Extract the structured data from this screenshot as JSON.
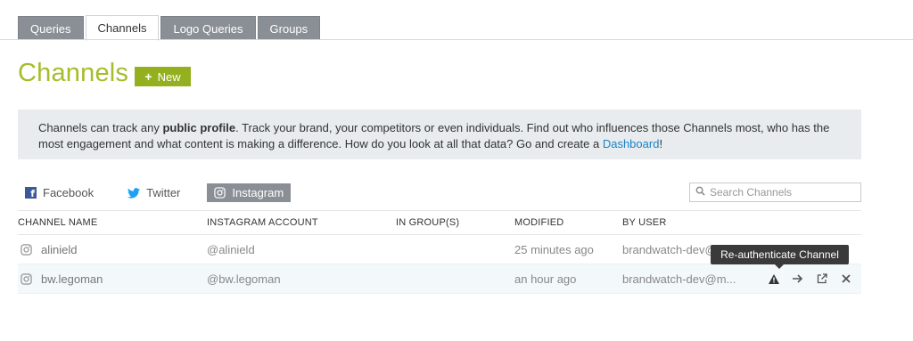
{
  "tabs": [
    {
      "label": "Queries",
      "active": false
    },
    {
      "label": "Channels",
      "active": true
    },
    {
      "label": "Logo Queries",
      "active": false
    },
    {
      "label": "Groups",
      "active": false
    }
  ],
  "page": {
    "title": "Channels",
    "new_label": "New"
  },
  "info": {
    "text_1": "Channels can track any ",
    "bold": "public profile",
    "text_2": ". Track your brand, your competitors or even individuals. Find out who influences those Channels most, who has the most engagement and what content is making a difference. How do you look at all that data? Go and create a ",
    "link": "Dashboard",
    "text_3": "!"
  },
  "networks": [
    {
      "label": "Facebook",
      "icon": "facebook-icon",
      "active": false
    },
    {
      "label": "Twitter",
      "icon": "twitter-icon",
      "active": false
    },
    {
      "label": "Instagram",
      "icon": "instagram-icon",
      "active": true
    }
  ],
  "search": {
    "placeholder": "Search Channels"
  },
  "table": {
    "headers": [
      "CHANNEL NAME",
      "INSTAGRAM ACCOUNT",
      "IN GROUP(S)",
      "MODIFIED",
      "BY USER"
    ],
    "rows": [
      {
        "name": "alinield",
        "account": "@alinield",
        "groups": "",
        "modified": "25 minutes ago",
        "user": "brandwatch-dev@"
      },
      {
        "name": "bw.legoman",
        "account": "@bw.legoman",
        "groups": "",
        "modified": "an hour ago",
        "user": "brandwatch-dev@m..."
      }
    ]
  },
  "tooltip": {
    "text": "Re-authenticate Channel"
  },
  "colors": {
    "accent": "#a6bc2a",
    "button": "#94b01f",
    "tab_inactive": "#8a8f96",
    "link": "#1c82c8",
    "banner": "#e8ecee"
  }
}
